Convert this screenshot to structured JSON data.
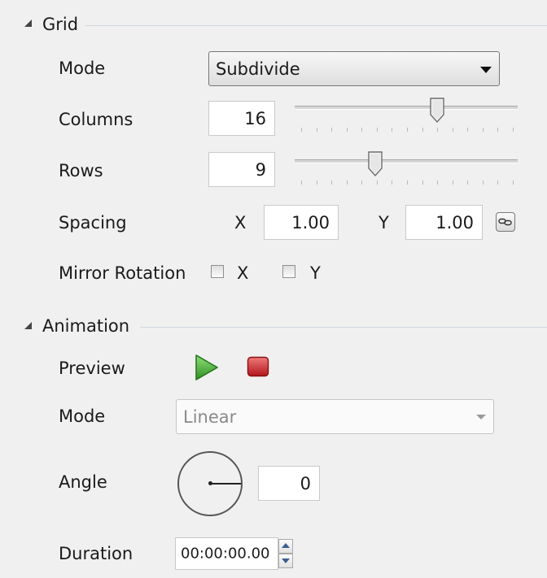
{
  "grid": {
    "title": "Grid",
    "mode_label": "Mode",
    "mode_value": "Subdivide",
    "columns_label": "Columns",
    "columns_value": "16",
    "columns_slider_fraction": 0.64,
    "rows_label": "Rows",
    "rows_value": "9",
    "rows_slider_fraction": 0.36,
    "spacing_label": "Spacing",
    "spacing_x_label": "X",
    "spacing_x_value": "1.00",
    "spacing_y_label": "Y",
    "spacing_y_value": "1.00",
    "mirror_label": "Mirror Rotation",
    "mirror_x_label": "X",
    "mirror_y_label": "Y",
    "mirror_x_checked": false,
    "mirror_y_checked": false
  },
  "animation": {
    "title": "Animation",
    "preview_label": "Preview",
    "mode_label": "Mode",
    "mode_value": "Linear",
    "angle_label": "Angle",
    "angle_value": "0",
    "duration_label": "Duration",
    "duration_value": "00:00:00.00"
  },
  "icons": {
    "expand": "triangle-collapse-icon",
    "play": "play-icon",
    "stop": "stop-icon",
    "link": "link-icon",
    "dropdown": "chevron-down-icon",
    "spin_up": "spin-up-icon",
    "spin_down": "spin-down-icon"
  },
  "colors": {
    "play": "#3aa12c",
    "stop": "#c8242a",
    "background": "#f0f0f0"
  }
}
